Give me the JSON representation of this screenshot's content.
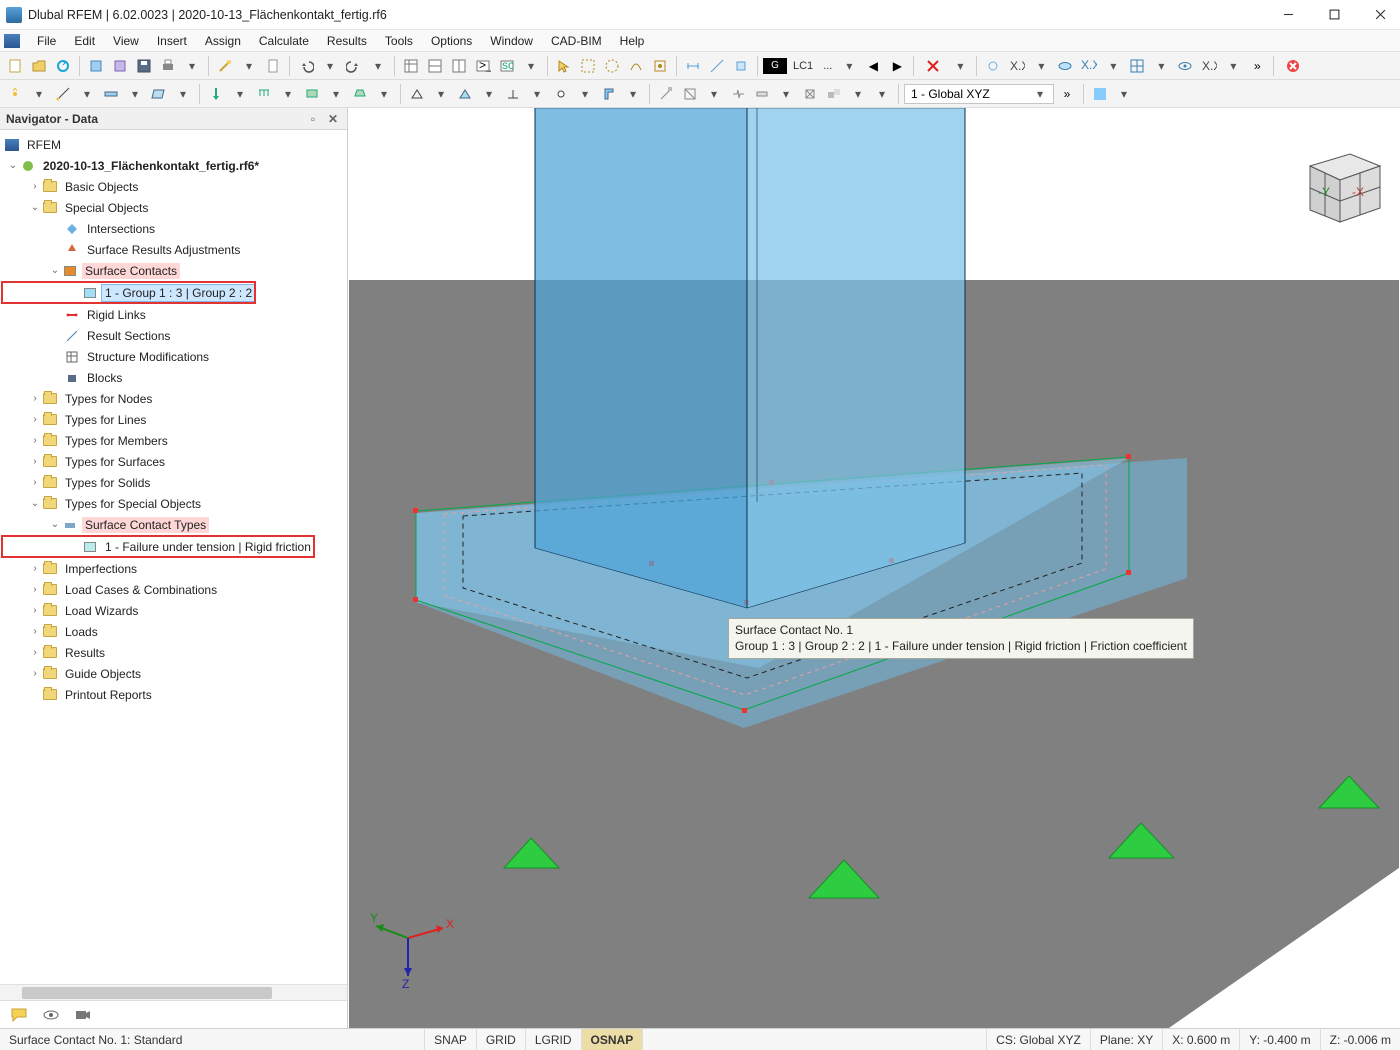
{
  "title": "Dlubal RFEM | 6.02.0023 | 2020-10-13_Flächenkontakt_fertig.rf6",
  "menu": [
    "File",
    "Edit",
    "View",
    "Insert",
    "Assign",
    "Calculate",
    "Results",
    "Tools",
    "Options",
    "Window",
    "CAD-BIM",
    "Help"
  ],
  "loadCaseTag": "G",
  "loadCase": "LC1",
  "coordDropdown": "1 - Global XYZ",
  "navigator": {
    "title": "Navigator - Data",
    "root": "RFEM",
    "file": "2020-10-13_Flächenkontakt_fertig.rf6*",
    "basic": "Basic Objects",
    "special": "Special Objects",
    "intersections": "Intersections",
    "sra": "Surface Results Adjustments",
    "sc": "Surface Contacts",
    "scItem": "1 - Group 1 : 3 | Group 2 : 2",
    "rigid": "Rigid Links",
    "resSec": "Result Sections",
    "strMod": "Structure Modifications",
    "blocks": "Blocks",
    "tnodes": "Types for Nodes",
    "tlines": "Types for Lines",
    "tmembers": "Types for Members",
    "tsurf": "Types for Surfaces",
    "tsolids": "Types for Solids",
    "tspecial": "Types for Special Objects",
    "sct": "Surface Contact Types",
    "sctItem": "1 - Failure under tension | Rigid friction",
    "imperf": "Imperfections",
    "lcc": "Load Cases & Combinations",
    "lwiz": "Load Wizards",
    "loads": "Loads",
    "results": "Results",
    "guide": "Guide Objects",
    "prr": "Printout Reports"
  },
  "tooltip": {
    "l1": "Surface Contact No. 1",
    "l2": "Group 1 : 3 | Group 2 : 2 | 1 - Failure under tension | Rigid friction | Friction coefficient"
  },
  "cubeAxes": {
    "y": "-Y",
    "x": "-X"
  },
  "triad": {
    "x": "X",
    "y": "Y",
    "z": "Z"
  },
  "status": {
    "left": "Surface Contact No. 1: Standard",
    "snap": "SNAP",
    "grid": "GRID",
    "lgrid": "LGRID",
    "osnap": "OSNAP",
    "cs": "CS: Global XYZ",
    "plane": "Plane: XY",
    "x": "X: 0.600 m",
    "y": "Y: -0.400 m",
    "z": "Z: -0.006 m"
  }
}
